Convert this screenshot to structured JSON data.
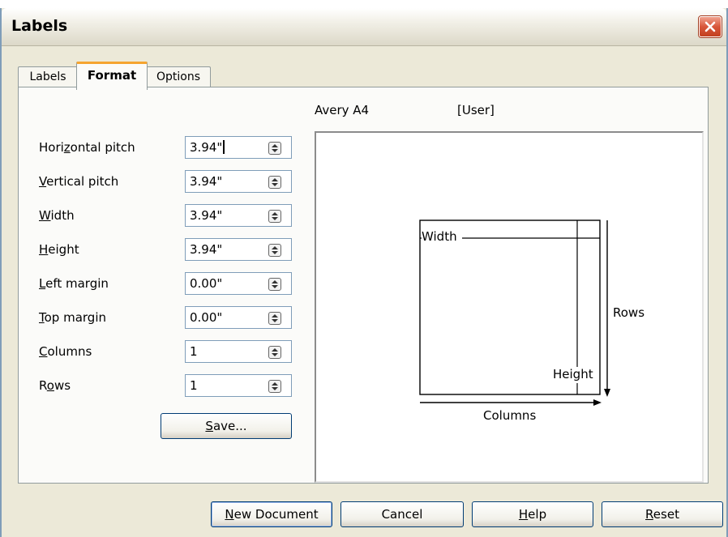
{
  "window": {
    "title": "Labels",
    "close_icon": "close-icon"
  },
  "tabs": [
    {
      "label": "Labels",
      "active": false
    },
    {
      "label": "Format",
      "active": true
    },
    {
      "label": "Options",
      "active": false
    }
  ],
  "fields": [
    {
      "key": "Hori",
      "mnemonic": "z",
      "rest": "ontal pitch",
      "value": "3.94\"",
      "focused": true
    },
    {
      "key": "",
      "mnemonic": "V",
      "rest": "ertical pitch",
      "value": "3.94\"",
      "focused": false
    },
    {
      "key": "",
      "mnemonic": "W",
      "rest": "idth",
      "value": "3.94\"",
      "focused": false
    },
    {
      "key": "",
      "mnemonic": "H",
      "rest": "eight",
      "value": "3.94\"",
      "focused": false
    },
    {
      "key": "",
      "mnemonic": "L",
      "rest": "eft margin",
      "value": "0.00\"",
      "focused": false
    },
    {
      "key": "",
      "mnemonic": "T",
      "rest": "op margin",
      "value": "0.00\"",
      "focused": false
    },
    {
      "key": "",
      "mnemonic": "C",
      "rest": "olumns",
      "value": "1",
      "focused": false
    },
    {
      "key": "R",
      "mnemonic": "o",
      "rest": "ws",
      "value": "1",
      "focused": false
    }
  ],
  "save_button": {
    "mnemonic": "S",
    "rest": "ave..."
  },
  "preview": {
    "brand": "Avery A4",
    "type": "[User]",
    "width_label": "Width",
    "height_label": "Height",
    "rows_label": "Rows",
    "columns_label": "Columns"
  },
  "buttons": [
    {
      "mnemonic": "N",
      "rest": "ew Document",
      "default": true
    },
    {
      "mnemonic": "",
      "rest": "Cancel",
      "default": false
    },
    {
      "mnemonic": "H",
      "rest": "elp",
      "default": false
    },
    {
      "mnemonic": "R",
      "rest": "eset",
      "default": false
    }
  ],
  "icons": {
    "spin": "spin-button-icon",
    "close": "close-icon"
  },
  "colors": {
    "dialog_bg": "#ECE9D8",
    "tab_accent": "#F5A430",
    "close_red": "#D8573A",
    "button_border": "#003C74"
  }
}
